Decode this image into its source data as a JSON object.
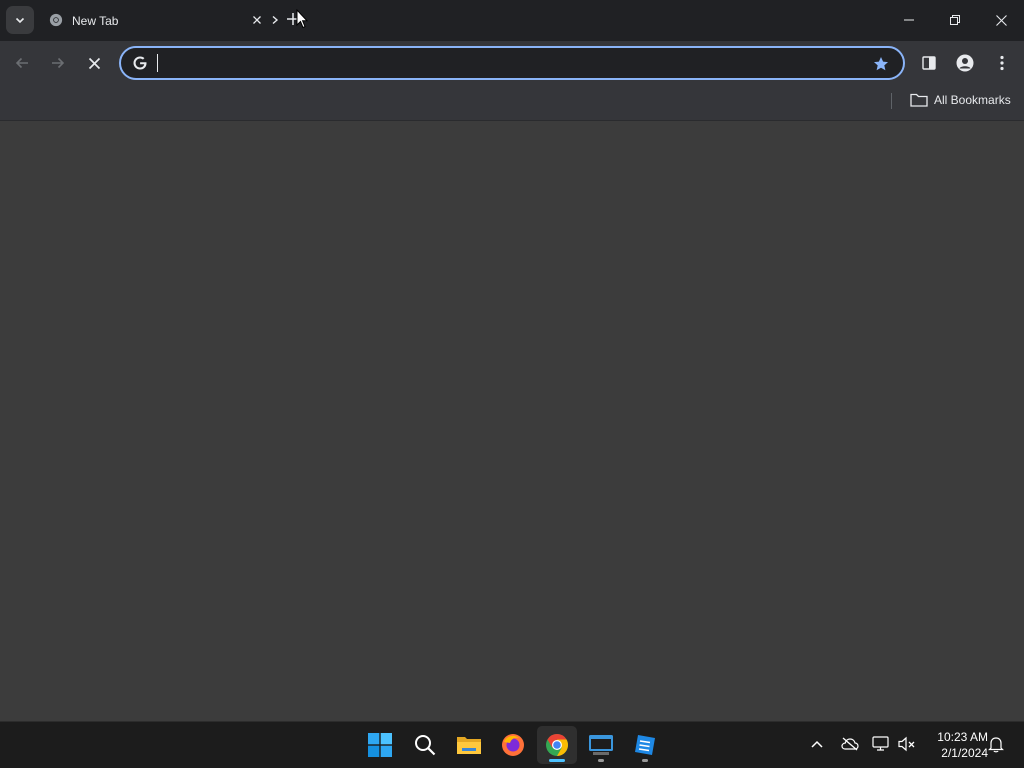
{
  "browser": {
    "tab": {
      "title": "New Tab"
    },
    "omnibox": {
      "value": "",
      "placeholder": ""
    },
    "bookmarks_bar": {
      "all_bookmarks_label": "All Bookmarks"
    }
  },
  "taskbar": {
    "apps": [
      "start-icon",
      "search-icon",
      "file-explorer-icon",
      "firefox-icon",
      "chrome-icon",
      "terminal-icon",
      "app-icon"
    ],
    "clock": {
      "time": "10:23 AM",
      "date": "2/1/2024"
    }
  },
  "colors": {
    "accent": "#8ab4f8",
    "tab_strip": "#202124",
    "toolbar": "#35363a",
    "content": "#3c3c3c",
    "taskbar": "#1c1c1c"
  }
}
